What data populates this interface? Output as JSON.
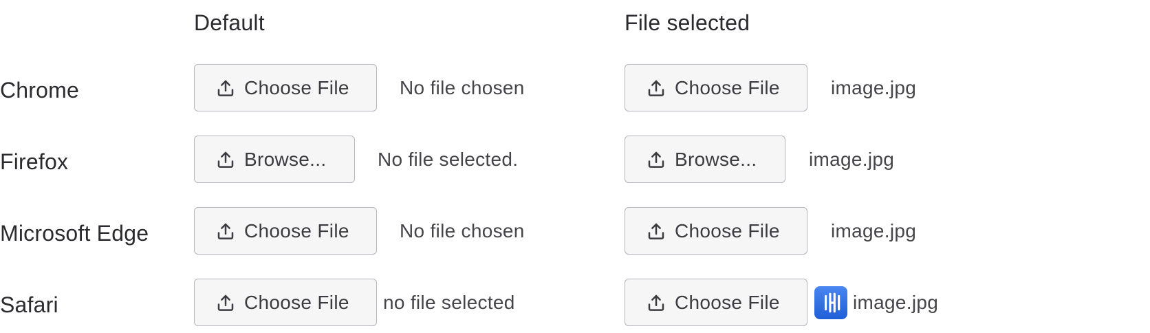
{
  "columns": {
    "default": "Default",
    "selected": "File selected"
  },
  "rows": [
    {
      "browser": "Chrome",
      "default_button": "Choose File",
      "default_status": "No file chosen",
      "selected_button": "Choose File",
      "selected_status": "image.jpg"
    },
    {
      "browser": "Firefox",
      "default_button": "Browse...",
      "default_status": "No file selected.",
      "selected_button": "Browse...",
      "selected_status": "image.jpg"
    },
    {
      "browser": "Microsoft Edge",
      "default_button": "Choose File",
      "default_status": "No file chosen",
      "selected_button": "Choose File",
      "selected_status": "image.jpg"
    },
    {
      "browser": "Safari",
      "default_button": "Choose File",
      "default_status": "no file selected",
      "selected_button": "Choose File",
      "selected_status": "image.jpg",
      "selected_file_icon": "image-file-thumbnail-icon"
    }
  ],
  "icons": {
    "button": "upload-icon"
  },
  "colors": {
    "button_bg": "#f6f6f7",
    "button_border": "#b5b5bb",
    "text": "#2b2b2f",
    "thumbnail": "#2f6fe4"
  }
}
